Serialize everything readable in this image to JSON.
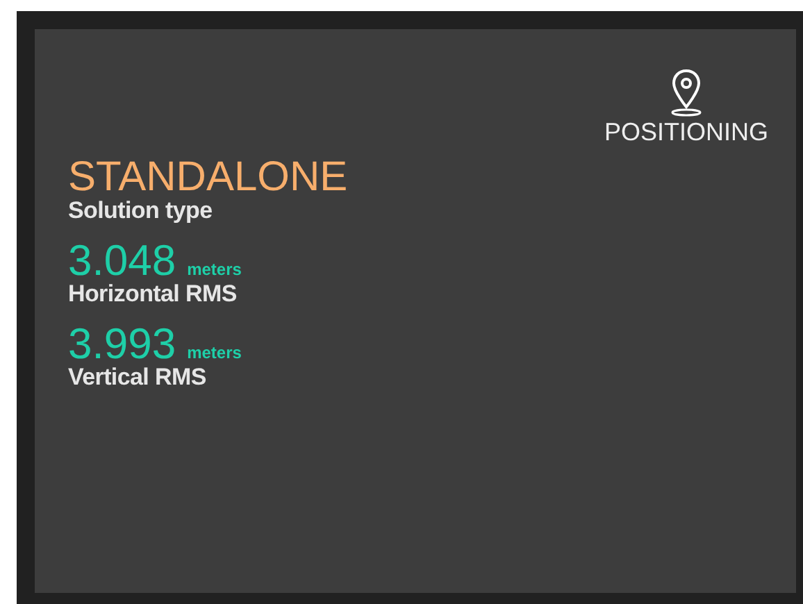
{
  "header": {
    "label": "POSITIONING"
  },
  "solution": {
    "value": "STANDALONE",
    "label": "Solution type"
  },
  "metrics": [
    {
      "value": "3.048",
      "unit": "meters",
      "label": "Horizontal RMS"
    },
    {
      "value": "3.993",
      "unit": "meters",
      "label": "Vertical RMS"
    }
  ]
}
